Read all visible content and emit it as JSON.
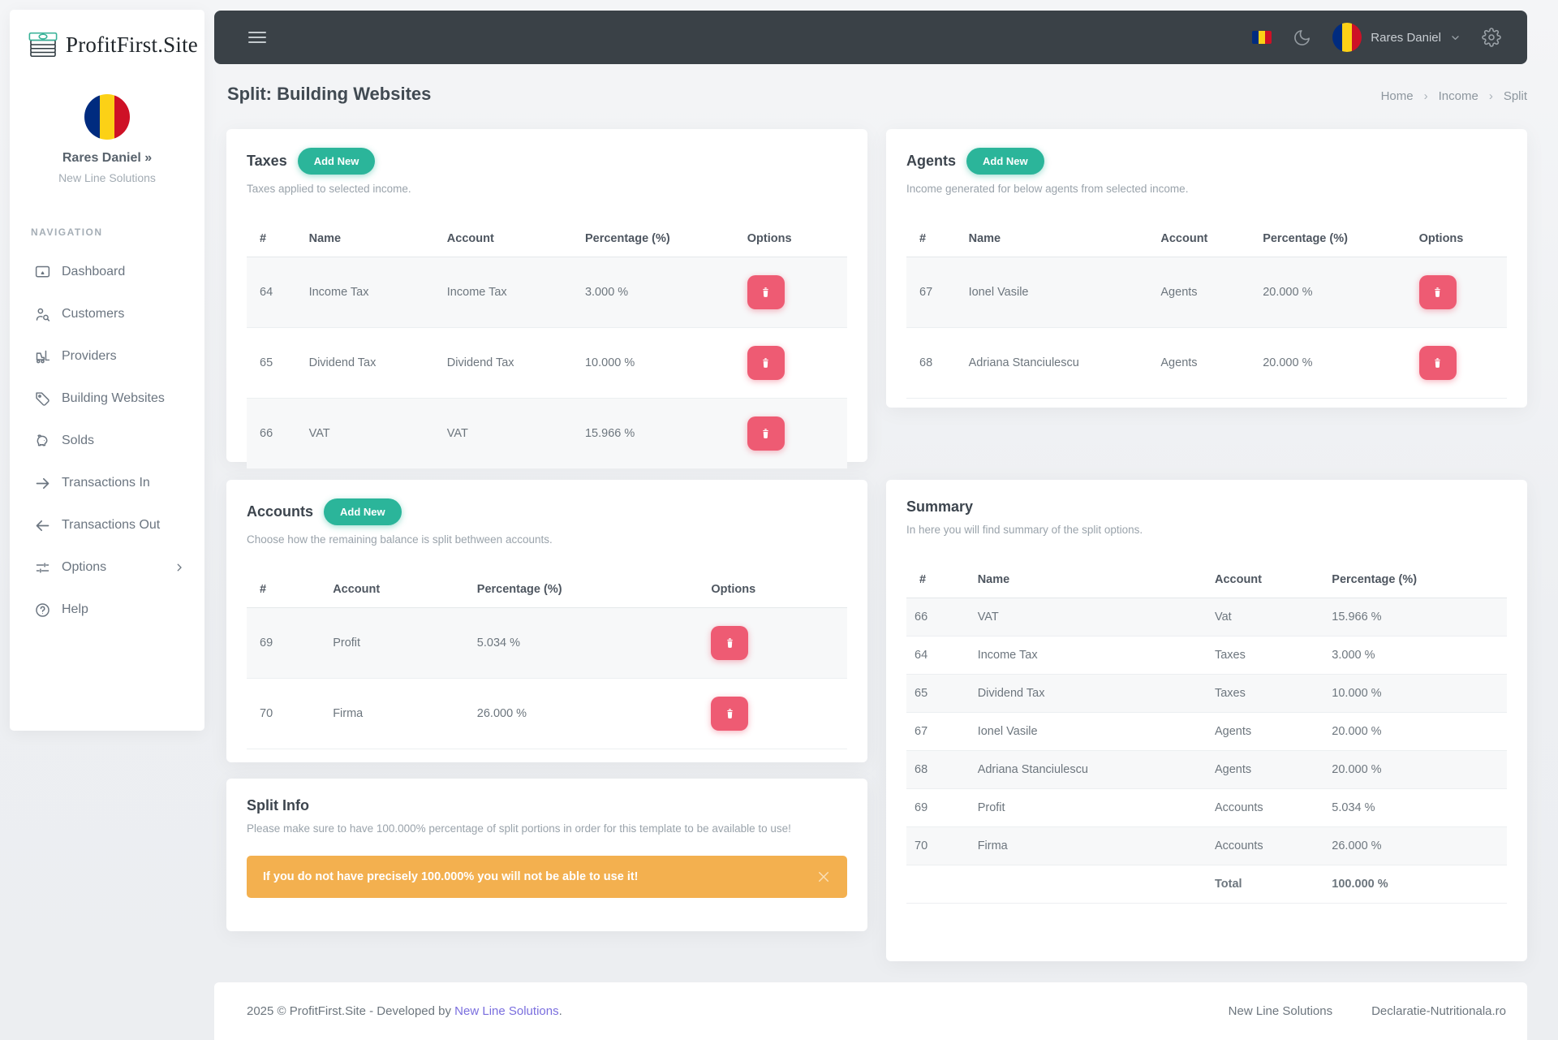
{
  "brand": {
    "name": "ProfitFirst.Site"
  },
  "navbar": {
    "user_name": "Rares Daniel"
  },
  "profile": {
    "name": "Rares Daniel »",
    "company": "New Line Solutions"
  },
  "sidebar": {
    "section": "NAVIGATION",
    "items": [
      {
        "label": "Dashboard",
        "icon": "monitor-icon"
      },
      {
        "label": "Customers",
        "icon": "user-search-icon"
      },
      {
        "label": "Providers",
        "icon": "forklift-icon"
      },
      {
        "label": "Building Websites",
        "icon": "tag-icon"
      },
      {
        "label": "Solds",
        "icon": "piggy-bank-icon"
      },
      {
        "label": "Transactions In",
        "icon": "arrow-right-icon"
      },
      {
        "label": "Transactions Out",
        "icon": "arrow-left-icon"
      },
      {
        "label": "Options",
        "icon": "sliders-icon"
      },
      {
        "label": "Help",
        "icon": "help-circle-icon"
      }
    ]
  },
  "page": {
    "title": "Split: Building Websites",
    "breadcrumb": [
      "Home",
      "Income",
      "Split"
    ],
    "separator": "›"
  },
  "cards": {
    "taxes": {
      "title": "Taxes",
      "add_button": "Add New",
      "subtitle": "Taxes applied to selected income.",
      "headers": [
        "#",
        "Name",
        "Account",
        "Percentage (%)",
        "Options"
      ],
      "rows": [
        [
          "64",
          "Income Tax",
          "Income Tax",
          "3.000 %"
        ],
        [
          "65",
          "Dividend Tax",
          "Dividend Tax",
          "10.000 %"
        ],
        [
          "66",
          "VAT",
          "VAT",
          "15.966 %"
        ]
      ]
    },
    "agents": {
      "title": "Agents",
      "add_button": "Add New",
      "subtitle": "Income generated for below agents from selected income.",
      "headers": [
        "#",
        "Name",
        "Account",
        "Percentage (%)",
        "Options"
      ],
      "rows": [
        [
          "67",
          "Ionel Vasile",
          "Agents",
          "20.000 %"
        ],
        [
          "68",
          "Adriana Stanciulescu",
          "Agents",
          "20.000 %"
        ]
      ]
    },
    "accounts": {
      "title": "Accounts",
      "add_button": "Add New",
      "subtitle": "Choose how the remaining balance is split bethween accounts.",
      "headers": [
        "#",
        "Account",
        "Percentage (%)",
        "Options"
      ],
      "rows": [
        [
          "69",
          "Profit",
          "5.034 %"
        ],
        [
          "70",
          "Firma",
          "26.000 %"
        ]
      ]
    },
    "summary": {
      "title": "Summary",
      "subtitle": "In here you will find summary of the split options.",
      "headers": [
        "#",
        "Name",
        "Account",
        "Percentage (%)"
      ],
      "rows": [
        [
          "66",
          "VAT",
          "Vat",
          "15.966 %"
        ],
        [
          "64",
          "Income Tax",
          "Taxes",
          "3.000 %"
        ],
        [
          "65",
          "Dividend Tax",
          "Taxes",
          "10.000 %"
        ],
        [
          "67",
          "Ionel Vasile",
          "Agents",
          "20.000 %"
        ],
        [
          "68",
          "Adriana Stanciulescu",
          "Agents",
          "20.000 %"
        ],
        [
          "69",
          "Profit",
          "Accounts",
          "5.034 %"
        ],
        [
          "70",
          "Firma",
          "Accounts",
          "26.000 %"
        ]
      ],
      "total_label": "Total",
      "total_value": "100.000 %"
    },
    "split_info": {
      "title": "Split Info",
      "subtitle": "Please make sure to have 100.000% percentage of split portions in order for this template to be available to use!",
      "alert_text": "If you do not have precisely 100.000% you will not be able to use it!"
    }
  },
  "footer": {
    "copyright_prefix": "2025 © ProfitFirst.Site - Developed by ",
    "copyright_link": "New Line Solutions",
    "copyright_suffix": ".",
    "links": [
      "New Line Solutions",
      "Declaratie-Nutritionala.ro"
    ]
  },
  "colors": {
    "navbar_bg": "#3a4147",
    "accent_teal": "#2bb59a",
    "danger": "#ee5b73",
    "warning": "#f3b04f",
    "success_text": "#21a121",
    "link_purple": "#7a6ede"
  }
}
